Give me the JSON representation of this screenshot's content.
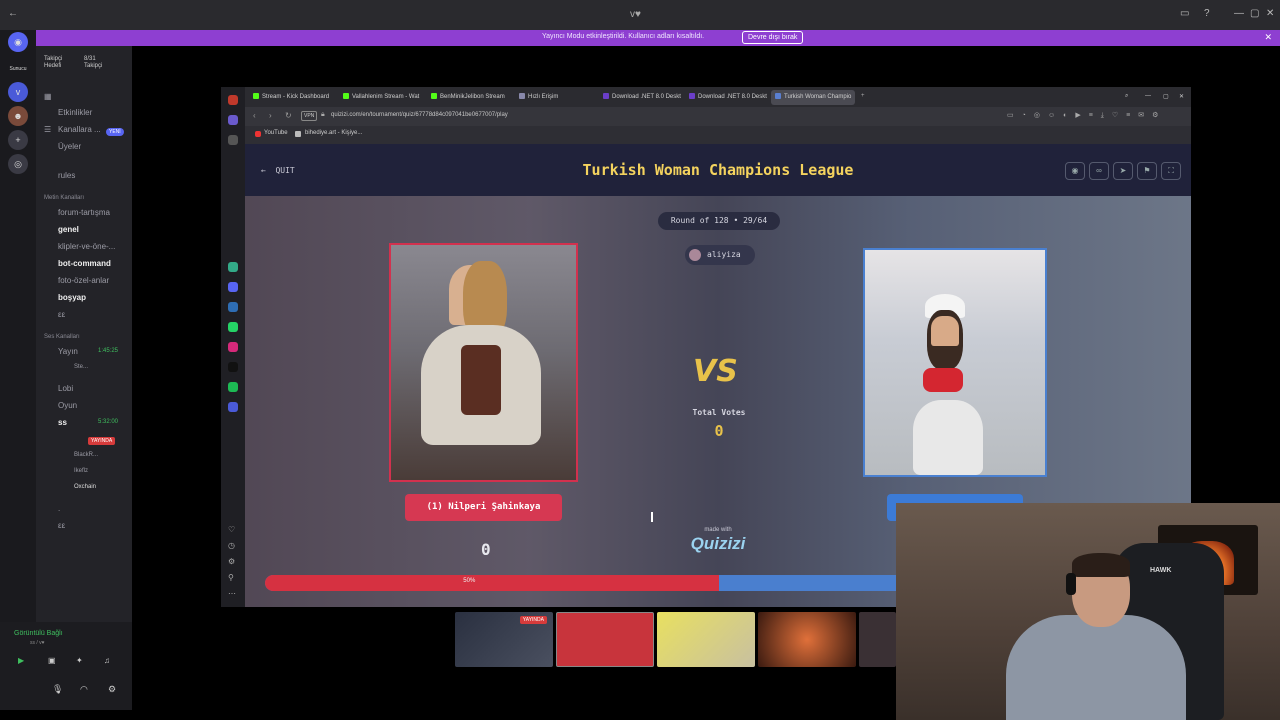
{
  "os": {
    "title": "ᴠ♥"
  },
  "banner": {
    "message": "Yayıncı Modu etkinleştirildi. Kullanıcı adları kısaltıldı.",
    "button": "Devre dışı bırak"
  },
  "discord": {
    "server_label": "Sunucu",
    "goal": {
      "label": "Takipçi Hedefi",
      "value": "8/31",
      "unit": "Takipçi"
    },
    "items": {
      "events": "Etkinlikler",
      "channels": "Kanallara ...",
      "new_badge": "YENİ",
      "members": "Üyeler",
      "rules": "rules"
    },
    "text_category": "Metin Kanalları",
    "text_channels": [
      "forum-tartışma",
      "genel",
      "klipler-ve-öne-...",
      "bot-command",
      "foto-özel-anlar",
      "boşyap",
      "εε"
    ],
    "voice_category": "Ses Kanalları",
    "voice": {
      "yayin": "Yayın",
      "yayin_time": "1:45:25",
      "stream_user": "Ste...",
      "lobi": "Lobi",
      "oyun": "Oyun",
      "ss": "ss",
      "ss_time": "5:32:00",
      "live_badge": "YAYINDA",
      "users": [
        "BlackR...",
        "Ikeflz",
        "Oxchain"
      ],
      "dot_channel": ".",
      "ee": "εε"
    },
    "connection": {
      "status": "Görüntülü Bağlı",
      "sub": "ss / ᴠ♥"
    }
  },
  "browser": {
    "tabs": [
      {
        "label": "Stream - Kick Dashboard",
        "color": "#53fc18"
      },
      {
        "label": "Vallahlenim Stream - Wat",
        "color": "#53fc18"
      },
      {
        "label": "BenMinikJelibon Stream",
        "color": "#53fc18"
      },
      {
        "label": "Hızlı Erişim",
        "color": "#8888aa"
      },
      {
        "label": "Download .NET 8.0 Deskt",
        "color": "#6b3ec8"
      },
      {
        "label": "Download .NET 8.0 Deskt",
        "color": "#6b3ec8"
      },
      {
        "label": "Turkish Woman Champio",
        "color": "#5a7fd0"
      }
    ],
    "vpn": "VPN",
    "url": "quizizi.com/en/tournament/quiz/67778d84c097041be0677007/play",
    "bookmarks": [
      "YouTube",
      "bihediye.art - Kişiye..."
    ]
  },
  "quiz": {
    "quit": "QUIT",
    "title": "Turkish Woman Champions League",
    "round": "Round of 128 • 29/64",
    "user": "aliyiza",
    "vs": "VS",
    "total_votes_label": "Total Votes",
    "total_votes": "0",
    "left_name": "(1) Nilperi Şahinkaya",
    "left_votes": "0",
    "made_with": "made with",
    "logo": "Quizizi",
    "progress": {
      "left_fraction": 0.5,
      "label": "50%"
    },
    "left_color": "#d63141",
    "right_color": "#4a7fcf"
  },
  "webcam": {
    "chair_brand": "HAWK"
  },
  "thumbnails": {
    "live_badge": "YAYINDA"
  }
}
